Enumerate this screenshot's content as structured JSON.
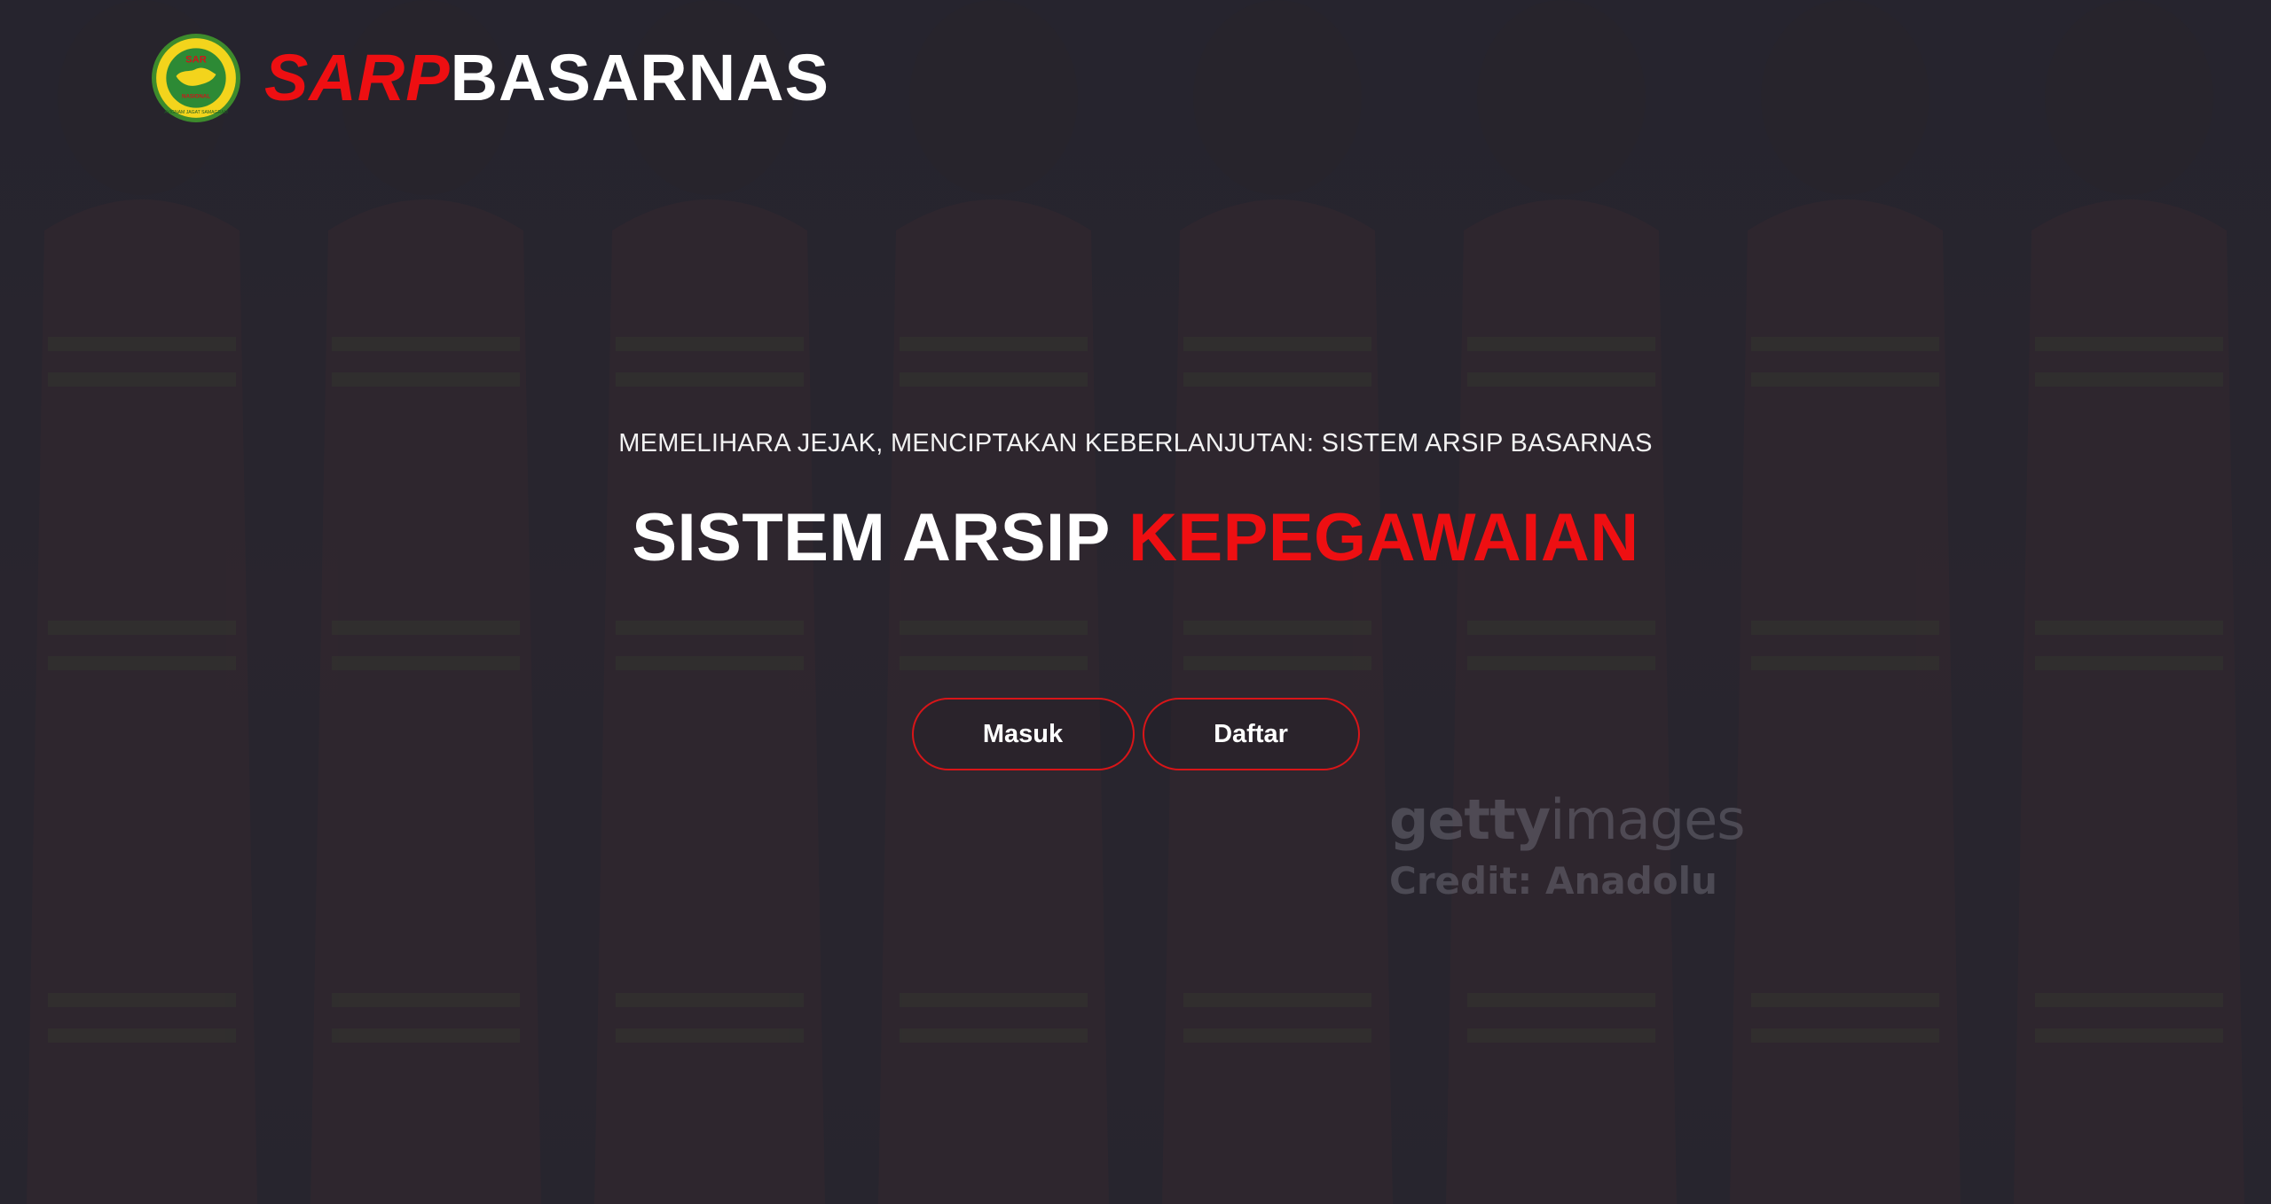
{
  "brand": {
    "accent_text": "SARP",
    "rest_text": "BASARNAS",
    "logo_icon": "basarnas-emblem-icon",
    "logo_text_top": "SAR",
    "logo_text_mid": "NASIONAL",
    "logo_text_bottom": "AVIGNAM JAGAT SAMAGRAM"
  },
  "hero": {
    "tagline": "MEMELIHARA JEJAK, MENCIPTAKAN KEBERLANJUTAN: SISTEM ARSIP BASARNAS",
    "headline_white": "SISTEM ARSIP ",
    "headline_red": "KEPEGAWAIAN"
  },
  "actions": {
    "login_label": "Masuk",
    "register_label": "Daftar"
  },
  "watermark": {
    "brand_bold": "getty",
    "brand_light": "images",
    "credit": "Credit: Anadolu"
  },
  "colors": {
    "accent": "#ee0f12",
    "background": "#2a2933",
    "text": "#ffffff"
  }
}
